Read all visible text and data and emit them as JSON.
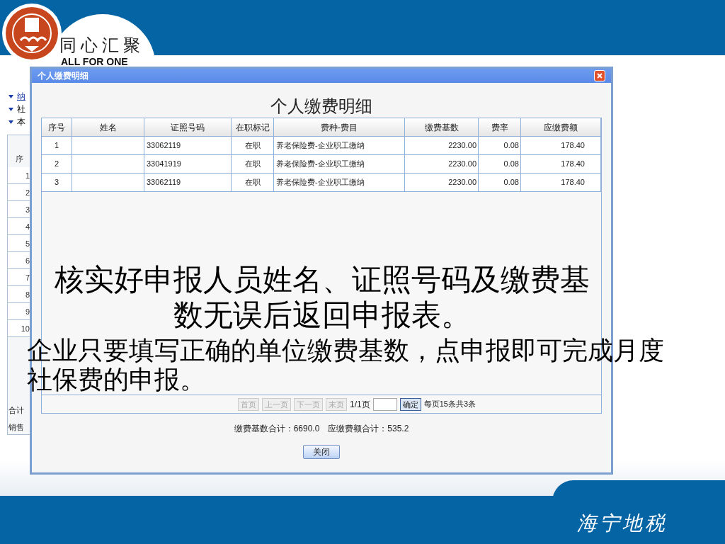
{
  "slide": {
    "logo_text": "同心汇聚",
    "logo_subtitle": "ALL FOR ONE",
    "footer": "海宁地税"
  },
  "background_page": {
    "links": [
      {
        "label": "纳",
        "kind": "link"
      },
      {
        "label": "社",
        "kind": "text"
      },
      {
        "label": "本",
        "kind": "text"
      }
    ],
    "table": {
      "header": "序",
      "rows": [
        "1",
        "2",
        "3",
        "4",
        "5",
        "6",
        "7",
        "8",
        "9",
        "10"
      ],
      "total": "合计",
      "footer_row": "销售"
    }
  },
  "dialog": {
    "title": "个人缴费明细",
    "heading": "个人缴费明细",
    "columns": [
      "序号",
      "姓名",
      "证照号码",
      "在职标记",
      "费种-费目",
      "缴费基数",
      "费率",
      "应缴费额"
    ],
    "rows": [
      {
        "no": "1",
        "id": "33062119",
        "status": "在职",
        "fee_type": "养老保险费-企业职工缴纳",
        "base": "2230.00",
        "rate": "0.08",
        "amount": "178.40"
      },
      {
        "no": "2",
        "id": "33041919",
        "status": "在职",
        "fee_type": "养老保险费-企业职工缴纳",
        "base": "2230.00",
        "rate": "0.08",
        "amount": "178.40"
      },
      {
        "no": "3",
        "id": "33062119",
        "status": "在职",
        "fee_type": "养老保险费-企业职工缴纳",
        "base": "2230.00",
        "rate": "0.08",
        "amount": "178.40"
      }
    ],
    "pager": {
      "buttons": [
        {
          "label": "首页",
          "disabled": true
        },
        {
          "label": "上一页",
          "disabled": true
        },
        {
          "label": "下一页",
          "disabled": true
        },
        {
          "label": "末页",
          "disabled": true
        }
      ],
      "page": "1/1页",
      "go": "确定",
      "info": "每页15条共3条"
    },
    "totals": [
      "缴费基数合计：6690.0",
      "应缴费额合计：535.2"
    ],
    "close": "关闭"
  },
  "captions": [
    {
      "text": "核实好申报人员姓名、证照号码及缴费基数无误后返回申报表。"
    },
    {
      "text": "企业只要填写正确的单位缴费基数，点申报即可完成月度社保费的申报。"
    }
  ]
}
